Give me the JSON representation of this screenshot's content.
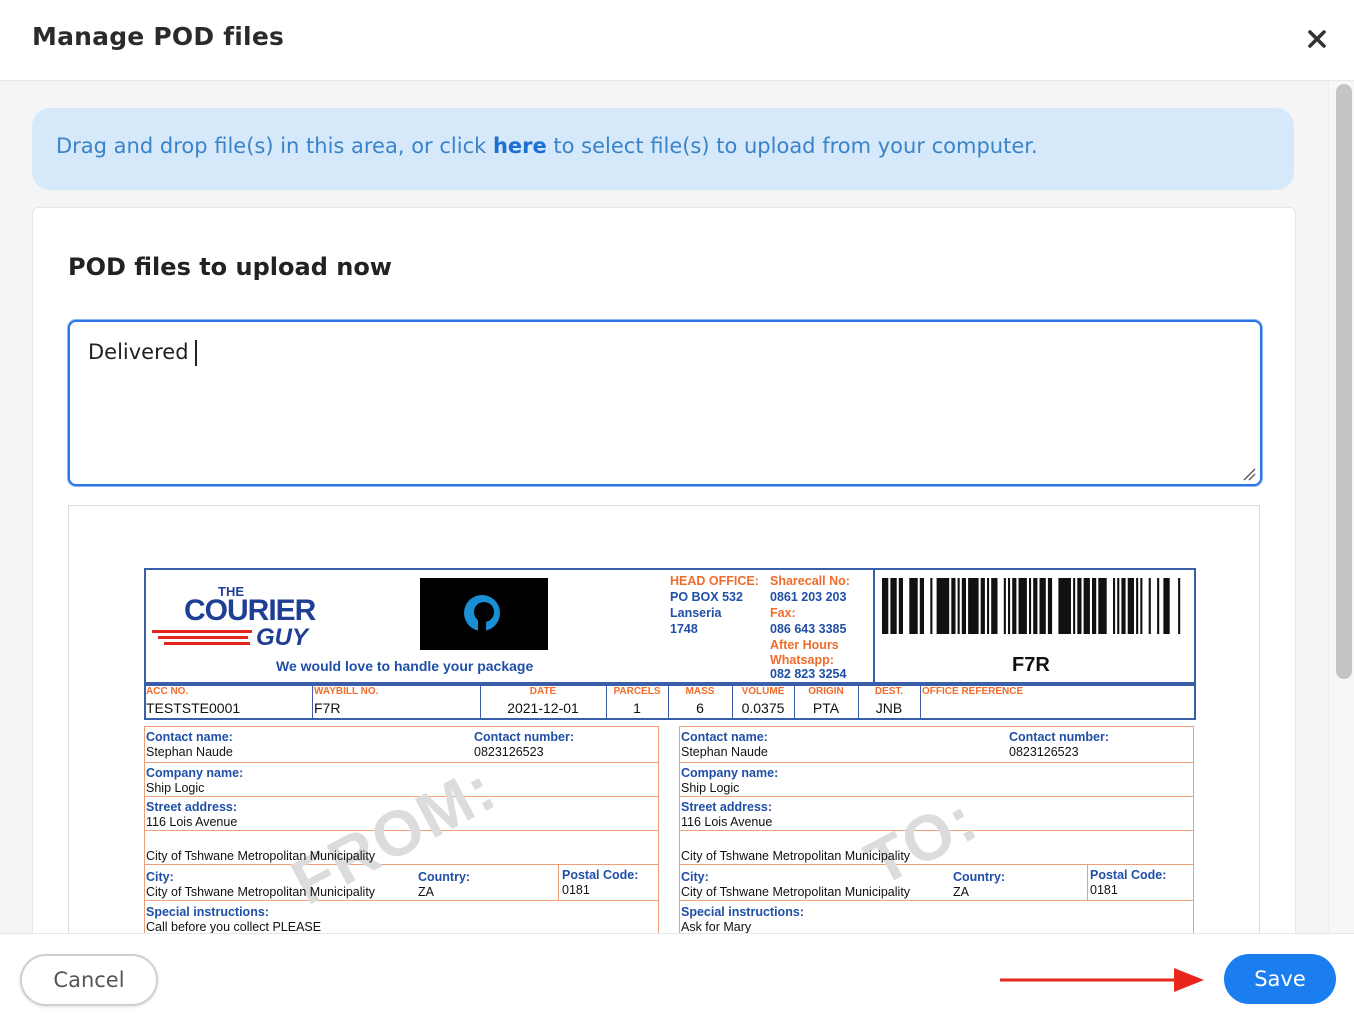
{
  "dialog": {
    "title": "Manage POD files"
  },
  "dropzone": {
    "text_before": "Drag and drop file(s) in this area, or click ",
    "link": "here",
    "text_after": " to select file(s) to upload from your computer."
  },
  "panel": {
    "title": "POD files to upload now",
    "note_value": "Delivered"
  },
  "waybill": {
    "logo_line1": "THE",
    "logo_line2": "COURIER",
    "logo_line3": "GUY",
    "tagline": "We would love to handle your package",
    "head_office_label": "HEAD OFFICE:",
    "head_office_lines": [
      "PO BOX 532",
      "Lanseria",
      "1748"
    ],
    "sharecall_label": "Sharecall No:",
    "sharecall_value": "0861 203 203",
    "fax_label": "Fax:",
    "fax_value": "086 643 3385",
    "after_hours_label": "After Hours",
    "whatsapp_label": "Whatsapp:",
    "whatsapp_value": "082 823 3254",
    "barcode_text": "F7R",
    "fields": [
      {
        "label": "ACC NO.",
        "value": "TESTSTE0001"
      },
      {
        "label": "WAYBILL NO.",
        "value": "F7R"
      },
      {
        "label": "DATE",
        "value": "2021-12-01"
      },
      {
        "label": "PARCELS",
        "value": "1"
      },
      {
        "label": "MASS",
        "value": "6"
      },
      {
        "label": "VOLUME",
        "value": "0.0375"
      },
      {
        "label": "ORIGIN",
        "value": "PTA"
      },
      {
        "label": "DEST.",
        "value": "JNB"
      },
      {
        "label": "OFFICE REFERENCE",
        "value": ""
      }
    ],
    "from": {
      "watermark": "FROM:",
      "contact_name_label": "Contact name:",
      "contact_name": "Stephan Naude",
      "contact_number_label": "Contact number:",
      "contact_number": "0823126523",
      "company_label": "Company name:",
      "company": "Ship Logic",
      "street_label": "Street address:",
      "street": "116 Lois Avenue",
      "suburb": "City of Tshwane Metropolitan Municipality",
      "city_label": "City:",
      "city": "City of Tshwane Metropolitan Municipality",
      "country_label": "Country:",
      "country": "ZA",
      "postal_label": "Postal Code:",
      "postal": "0181",
      "special_label": "Special instructions:",
      "special": "Call before you collect PLEASE"
    },
    "to": {
      "watermark": "TO:",
      "contact_name_label": "Contact name:",
      "contact_name": "Stephan Naude",
      "contact_number_label": "Contact number:",
      "contact_number": "0823126523",
      "company_label": "Company name:",
      "company": "Ship Logic",
      "street_label": "Street address:",
      "street": "116 Lois Avenue",
      "suburb": "City of Tshwane Metropolitan Municipality",
      "city_label": "City:",
      "city": "City of Tshwane Metropolitan Municipality",
      "country_label": "Country:",
      "country": "ZA",
      "postal_label": "Postal Code:",
      "postal": "0181",
      "special_label": "Special instructions:",
      "special": "Ask for Mary"
    }
  },
  "footer": {
    "cancel_label": "Cancel",
    "save_label": "Save"
  },
  "colors": {
    "primary": "#1a7df0",
    "dropzone_bg": "#d6e9fa",
    "annotation_arrow": "#e8261c"
  }
}
